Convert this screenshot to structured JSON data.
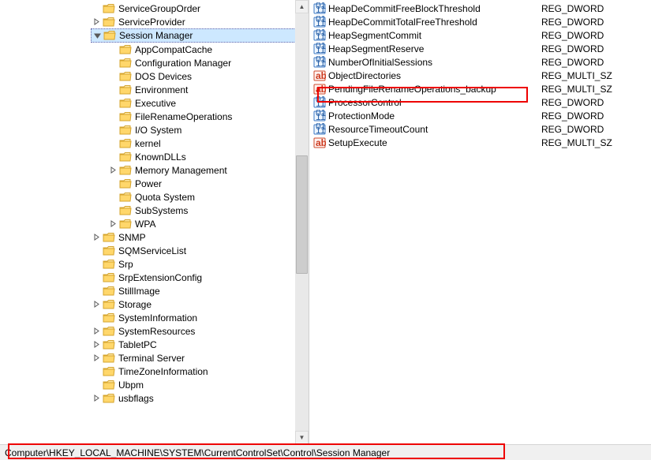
{
  "tree": {
    "level0": [
      {
        "label": "ServiceGroupOrder",
        "exp": "none"
      },
      {
        "label": "ServiceProvider",
        "exp": "closed"
      }
    ],
    "sessionManager": {
      "label": "Session Manager",
      "exp": "open",
      "selected": true
    },
    "smChildren": [
      {
        "label": "AppCompatCache",
        "exp": "none"
      },
      {
        "label": "Configuration Manager",
        "exp": "none"
      },
      {
        "label": "DOS Devices",
        "exp": "none"
      },
      {
        "label": "Environment",
        "exp": "none"
      },
      {
        "label": "Executive",
        "exp": "none"
      },
      {
        "label": "FileRenameOperations",
        "exp": "none"
      },
      {
        "label": "I/O System",
        "exp": "none"
      },
      {
        "label": "kernel",
        "exp": "none"
      },
      {
        "label": "KnownDLLs",
        "exp": "none"
      },
      {
        "label": "Memory Management",
        "exp": "closed"
      },
      {
        "label": "Power",
        "exp": "none"
      },
      {
        "label": "Quota System",
        "exp": "none"
      },
      {
        "label": "SubSystems",
        "exp": "none"
      },
      {
        "label": "WPA",
        "exp": "closed"
      }
    ],
    "siblingsAfter": [
      {
        "label": "SNMP",
        "exp": "closed"
      },
      {
        "label": "SQMServiceList",
        "exp": "none"
      },
      {
        "label": "Srp",
        "exp": "none"
      },
      {
        "label": "SrpExtensionConfig",
        "exp": "none"
      },
      {
        "label": "StillImage",
        "exp": "none"
      },
      {
        "label": "Storage",
        "exp": "closed"
      },
      {
        "label": "SystemInformation",
        "exp": "none"
      },
      {
        "label": "SystemResources",
        "exp": "closed"
      },
      {
        "label": "TabletPC",
        "exp": "closed"
      },
      {
        "label": "Terminal Server",
        "exp": "closed"
      },
      {
        "label": "TimeZoneInformation",
        "exp": "none"
      },
      {
        "label": "Ubpm",
        "exp": "none"
      },
      {
        "label": "usbflags",
        "exp": "closed"
      }
    ]
  },
  "values": [
    {
      "name": "HeapDeCommitFreeBlockThreshold",
      "type": "REG_DWORD",
      "icon": "bin"
    },
    {
      "name": "HeapDeCommitTotalFreeThreshold",
      "type": "REG_DWORD",
      "icon": "bin"
    },
    {
      "name": "HeapSegmentCommit",
      "type": "REG_DWORD",
      "icon": "bin"
    },
    {
      "name": "HeapSegmentReserve",
      "type": "REG_DWORD",
      "icon": "bin"
    },
    {
      "name": "NumberOfInitialSessions",
      "type": "REG_DWORD",
      "icon": "bin"
    },
    {
      "name": "ObjectDirectories",
      "type": "REG_MULTI_SZ",
      "icon": "str"
    },
    {
      "name": "PendingFileRenameOperations_backup",
      "type": "REG_MULTI_SZ",
      "icon": "str"
    },
    {
      "name": "ProcessorControl",
      "type": "REG_DWORD",
      "icon": "bin"
    },
    {
      "name": "ProtectionMode",
      "type": "REG_DWORD",
      "icon": "bin"
    },
    {
      "name": "ResourceTimeoutCount",
      "type": "REG_DWORD",
      "icon": "bin"
    },
    {
      "name": "SetupExecute",
      "type": "REG_MULTI_SZ",
      "icon": "str"
    }
  ],
  "statusPath": "Computer\\HKEY_LOCAL_MACHINE\\SYSTEM\\CurrentControlSet\\Control\\Session Manager"
}
